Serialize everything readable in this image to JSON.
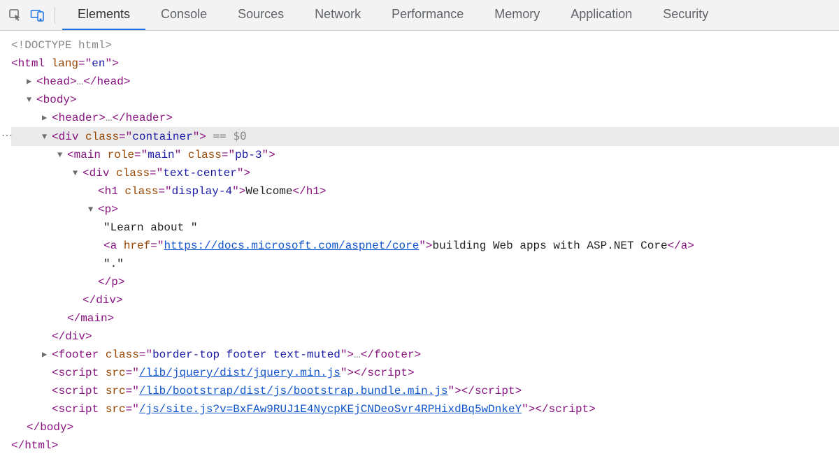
{
  "toolbar": {
    "tabs": [
      "Elements",
      "Console",
      "Sources",
      "Network",
      "Performance",
      "Memory",
      "Application",
      "Security"
    ],
    "activeTab": "Elements"
  },
  "dom": {
    "doctype": "<!DOCTYPE html>",
    "htmlOpen": {
      "tag": "html",
      "attr": "lang",
      "val": "en"
    },
    "headCollapsed": {
      "tag": "head",
      "ellipsis": "…"
    },
    "bodyOpen": {
      "tag": "body"
    },
    "headerCollapsed": {
      "tag": "header",
      "ellipsis": "…"
    },
    "containerDiv": {
      "tag": "div",
      "attr": "class",
      "val": "container",
      "consoleRef": "== $0"
    },
    "mainOpen": {
      "tag": "main",
      "attrs": [
        [
          "role",
          "main"
        ],
        [
          "class",
          "pb-3"
        ]
      ]
    },
    "textCenterDiv": {
      "tag": "div",
      "attr": "class",
      "val": "text-center"
    },
    "h1": {
      "tag": "h1",
      "attr": "class",
      "val": "display-4",
      "text": "Welcome"
    },
    "pOpen": {
      "tag": "p"
    },
    "textLearn": "\"Learn about \"",
    "anchor": {
      "tag": "a",
      "attr": "href",
      "val": "https://docs.microsoft.com/aspnet/core",
      "text": "building Web apps with ASP.NET Core"
    },
    "textDot": "\".\"",
    "pClose": "p",
    "divClose1": "div",
    "mainClose": "main",
    "divClose2": "div",
    "footer": {
      "tag": "footer",
      "attr": "class",
      "val": "border-top footer text-muted",
      "ellipsis": "…"
    },
    "script1": {
      "tag": "script",
      "attr": "src",
      "val": "/lib/jquery/dist/jquery.min.js"
    },
    "script2": {
      "tag": "script",
      "attr": "src",
      "val": "/lib/bootstrap/dist/js/bootstrap.bundle.min.js"
    },
    "script3": {
      "tag": "script",
      "attr": "src",
      "/js/site.js?v=": "",
      "val": "/js/site.js?v=BxFAw9RUJ1E4NycpKEjCNDeoSvr4RPHixdBq5wDnkeY"
    },
    "bodyClose": "body",
    "htmlClose": "html"
  }
}
